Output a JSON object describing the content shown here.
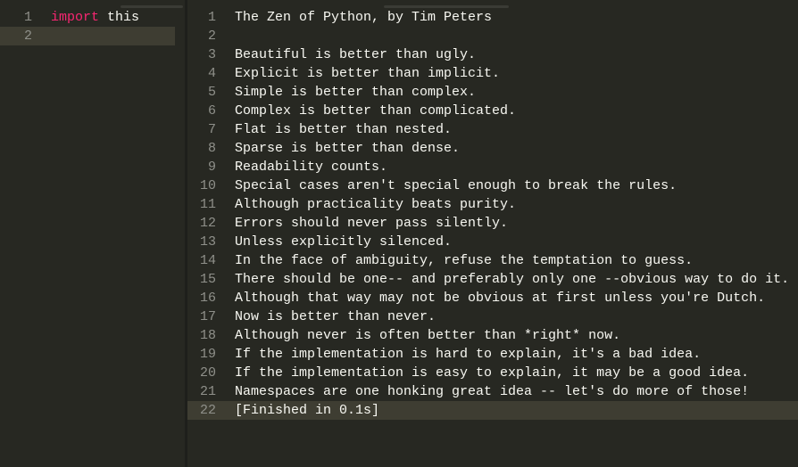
{
  "editor": {
    "lines": [
      {
        "keyword": "import",
        "text": " this"
      },
      {
        "keyword": "",
        "text": ""
      }
    ],
    "current_line": 2
  },
  "output": {
    "lines": [
      "The Zen of Python, by Tim Peters",
      "",
      "Beautiful is better than ugly.",
      "Explicit is better than implicit.",
      "Simple is better than complex.",
      "Complex is better than complicated.",
      "Flat is better than nested.",
      "Sparse is better than dense.",
      "Readability counts.",
      "Special cases aren't special enough to break the rules.",
      "Although practicality beats purity.",
      "Errors should never pass silently.",
      "Unless explicitly silenced.",
      "In the face of ambiguity, refuse the temptation to guess.",
      "There should be one-- and preferably only one --obvious way to do it.",
      "Although that way may not be obvious at first unless you're Dutch.",
      "Now is better than never.",
      "Although never is often better than *right* now.",
      "If the implementation is hard to explain, it's a bad idea.",
      "If the implementation is easy to explain, it may be a good idea.",
      "Namespaces are one honking great idea -- let's do more of those!",
      "[Finished in 0.1s]"
    ],
    "current_line": 22
  },
  "colors": {
    "background": "#272822",
    "keyword": "#f92672",
    "current_line": "#3e3d32",
    "gutter_text": "#8f908a"
  }
}
